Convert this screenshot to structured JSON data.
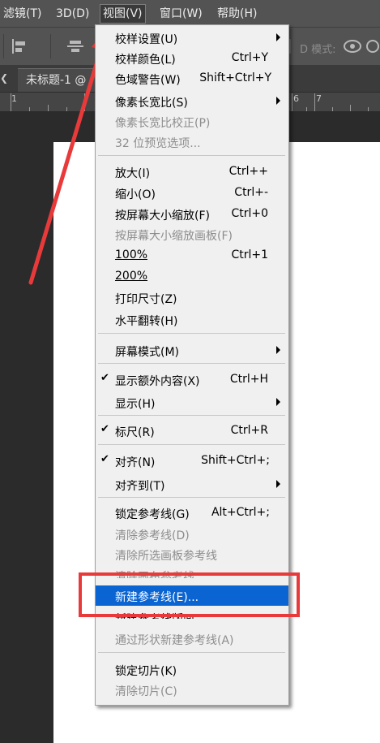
{
  "colors": {
    "menubar_bg": "#535353",
    "menu_bg": "#f0f0f0",
    "highlight": "#0a64d2",
    "annotation_red": "#e83a3a",
    "canvas": "#ffffff"
  },
  "menubar": {
    "items": [
      {
        "label": "滤镜(T)"
      },
      {
        "label": "3D(D)"
      },
      {
        "label": "视图(V)"
      },
      {
        "label": "窗口(W)"
      },
      {
        "label": "帮助(H)"
      }
    ]
  },
  "options_bar": {
    "mode_label": "D 模式:",
    "icons": [
      "align-icon",
      "align-center-icon",
      "distribute-icon",
      "3d-orbit-icon",
      "3d-pan-icon"
    ]
  },
  "tabs": [
    {
      "label": "未标题-1 @"
    }
  ],
  "ruler": {
    "numbers": [
      "1",
      "6",
      "7"
    ]
  },
  "view_menu": {
    "items": [
      {
        "label": "校样设置(U)",
        "shortcut": "",
        "submenu": true
      },
      {
        "label": "校样颜色(L)",
        "shortcut": "Ctrl+Y"
      },
      {
        "label": "色域警告(W)",
        "shortcut": "Shift+Ctrl+Y"
      },
      {
        "label": "像素长宽比(S)",
        "shortcut": "",
        "submenu": true
      },
      {
        "label": "像素长宽比校正(P)",
        "shortcut": "",
        "disabled": true
      },
      {
        "label": "32 位预览选项...",
        "shortcut": "",
        "disabled": true
      },
      {
        "label": "放大(I)",
        "shortcut": "Ctrl++"
      },
      {
        "label": "缩小(O)",
        "shortcut": "Ctrl+-"
      },
      {
        "label": "按屏幕大小缩放(F)",
        "shortcut": "Ctrl+0"
      },
      {
        "label": "按屏幕大小缩放画板(F)",
        "shortcut": "",
        "disabled": true
      },
      {
        "label": "100%",
        "shortcut": "Ctrl+1"
      },
      {
        "label": "200%",
        "shortcut": ""
      },
      {
        "label": "打印尺寸(Z)",
        "shortcut": ""
      },
      {
        "label": "水平翻转(H)",
        "shortcut": ""
      },
      {
        "label": "屏幕模式(M)",
        "shortcut": "",
        "submenu": true
      },
      {
        "label": "显示额外内容(X)",
        "shortcut": "Ctrl+H",
        "checked": true
      },
      {
        "label": "显示(H)",
        "shortcut": "",
        "submenu": true
      },
      {
        "label": "标尺(R)",
        "shortcut": "Ctrl+R",
        "checked": true
      },
      {
        "label": "对齐(N)",
        "shortcut": "Shift+Ctrl+;",
        "checked": true
      },
      {
        "label": "对齐到(T)",
        "shortcut": "",
        "submenu": true
      },
      {
        "label": "锁定参考线(G)",
        "shortcut": "Alt+Ctrl+;"
      },
      {
        "label": "清除参考线(D)",
        "shortcut": "",
        "disabled": true
      },
      {
        "label": "清除所选画板参考线",
        "shortcut": "",
        "disabled": true
      },
      {
        "label": "清除画布参考线",
        "shortcut": "",
        "disabled": true
      },
      {
        "label": "新建参考线(E)...",
        "shortcut": "",
        "highlighted": true
      },
      {
        "label": "新建参考线版面...",
        "shortcut": ""
      },
      {
        "label": "通过形状新建参考线(A)",
        "shortcut": "",
        "disabled": true
      },
      {
        "label": "锁定切片(K)",
        "shortcut": ""
      },
      {
        "label": "清除切片(C)",
        "shortcut": "",
        "disabled": true
      }
    ]
  }
}
